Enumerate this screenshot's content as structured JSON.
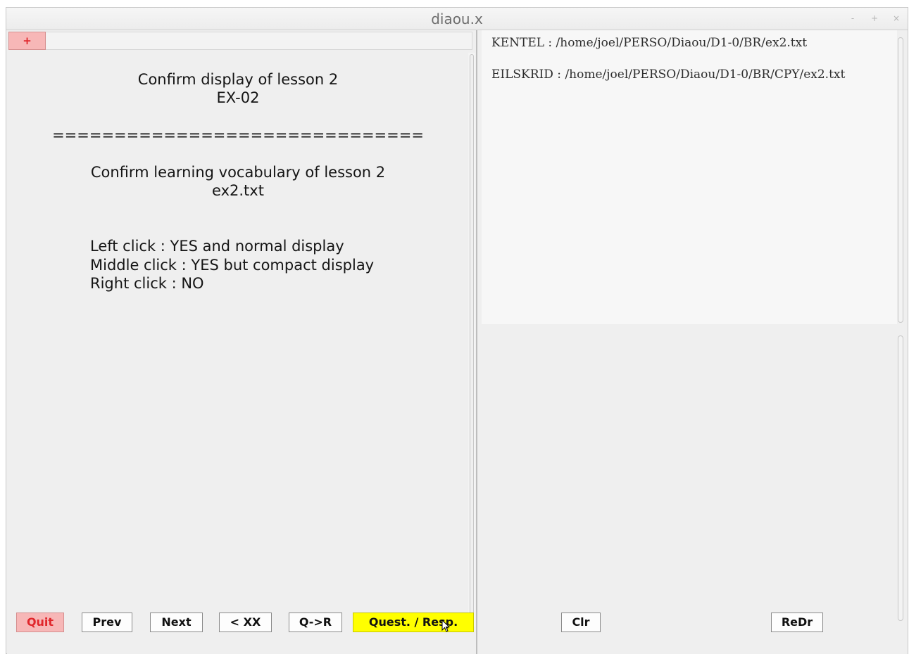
{
  "window": {
    "title": "diaou.x",
    "controls": {
      "minimize": "-",
      "maximize": "+",
      "close": "×"
    }
  },
  "left": {
    "tab_label": "+",
    "lines": {
      "confirm_display": "Confirm display of lesson 2",
      "exercise_code": "EX-02",
      "separator": "==============================",
      "confirm_learning": "Confirm learning vocabulary of lesson 2",
      "file_name": "ex2.txt",
      "left_click": "Left click : YES and normal display",
      "middle_click": "Middle click : YES but compact display",
      "right_click": "Right click : NO"
    }
  },
  "right": {
    "paths": [
      "KENTEL : /home/joel/PERSO/Diaou/D1-0/BR/ex2.txt",
      "EILSKRID : /home/joel/PERSO/Diaou/D1-0/BR/CPY/ex2.txt"
    ]
  },
  "buttons": {
    "quit": "Quit",
    "prev": "Prev",
    "next": "Next",
    "xx": "< XX",
    "q_to_r": "Q->R",
    "quest_resp": "Quest. / Resp.",
    "clr": "Clr",
    "redr": "ReDr"
  },
  "colors": {
    "quit_bg": "#f7b7b7",
    "quit_text": "#e0262b",
    "quest_resp_bg": "#ffff00",
    "panel_bg": "#efefef"
  }
}
